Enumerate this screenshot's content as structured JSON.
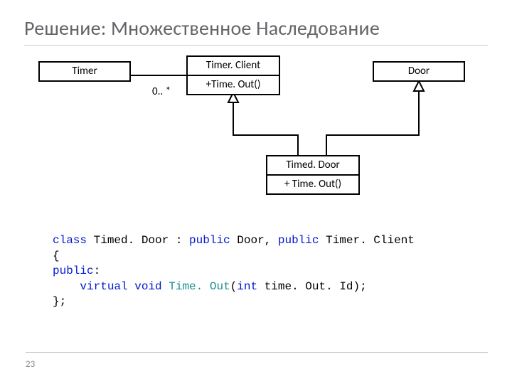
{
  "title": "Решение: Множественное Наследование",
  "page_number": "23",
  "diagram": {
    "timer": {
      "name": "Timer"
    },
    "timer_client": {
      "name": "Timer. Client",
      "op": "+Time. Out()"
    },
    "door": {
      "name": "Door"
    },
    "timed_door": {
      "name": "Timed. Door",
      "op": "+ Time. Out()"
    },
    "multiplicity": "0.. *"
  },
  "code": {
    "l1_kw1": "class",
    "l1_name": " Timed. Door : ",
    "l1_kw2": "public",
    "l1_base1": " Door, ",
    "l1_kw3": "public",
    "l1_base2": " Timer. Client",
    "l2_open": "{",
    "l3_kwpub": "public",
    "l3_colon": ":",
    "l4_indent": "    ",
    "l4_kw1": "virtual",
    "l4_sp1": " ",
    "l4_kw2": "void",
    "l4_sp2": " ",
    "l4_fn": "Time. Out",
    "l4_paren": "(",
    "l4_kw3": "int",
    "l4_arg": " time. Out. Id);",
    "l5_close": "};"
  }
}
